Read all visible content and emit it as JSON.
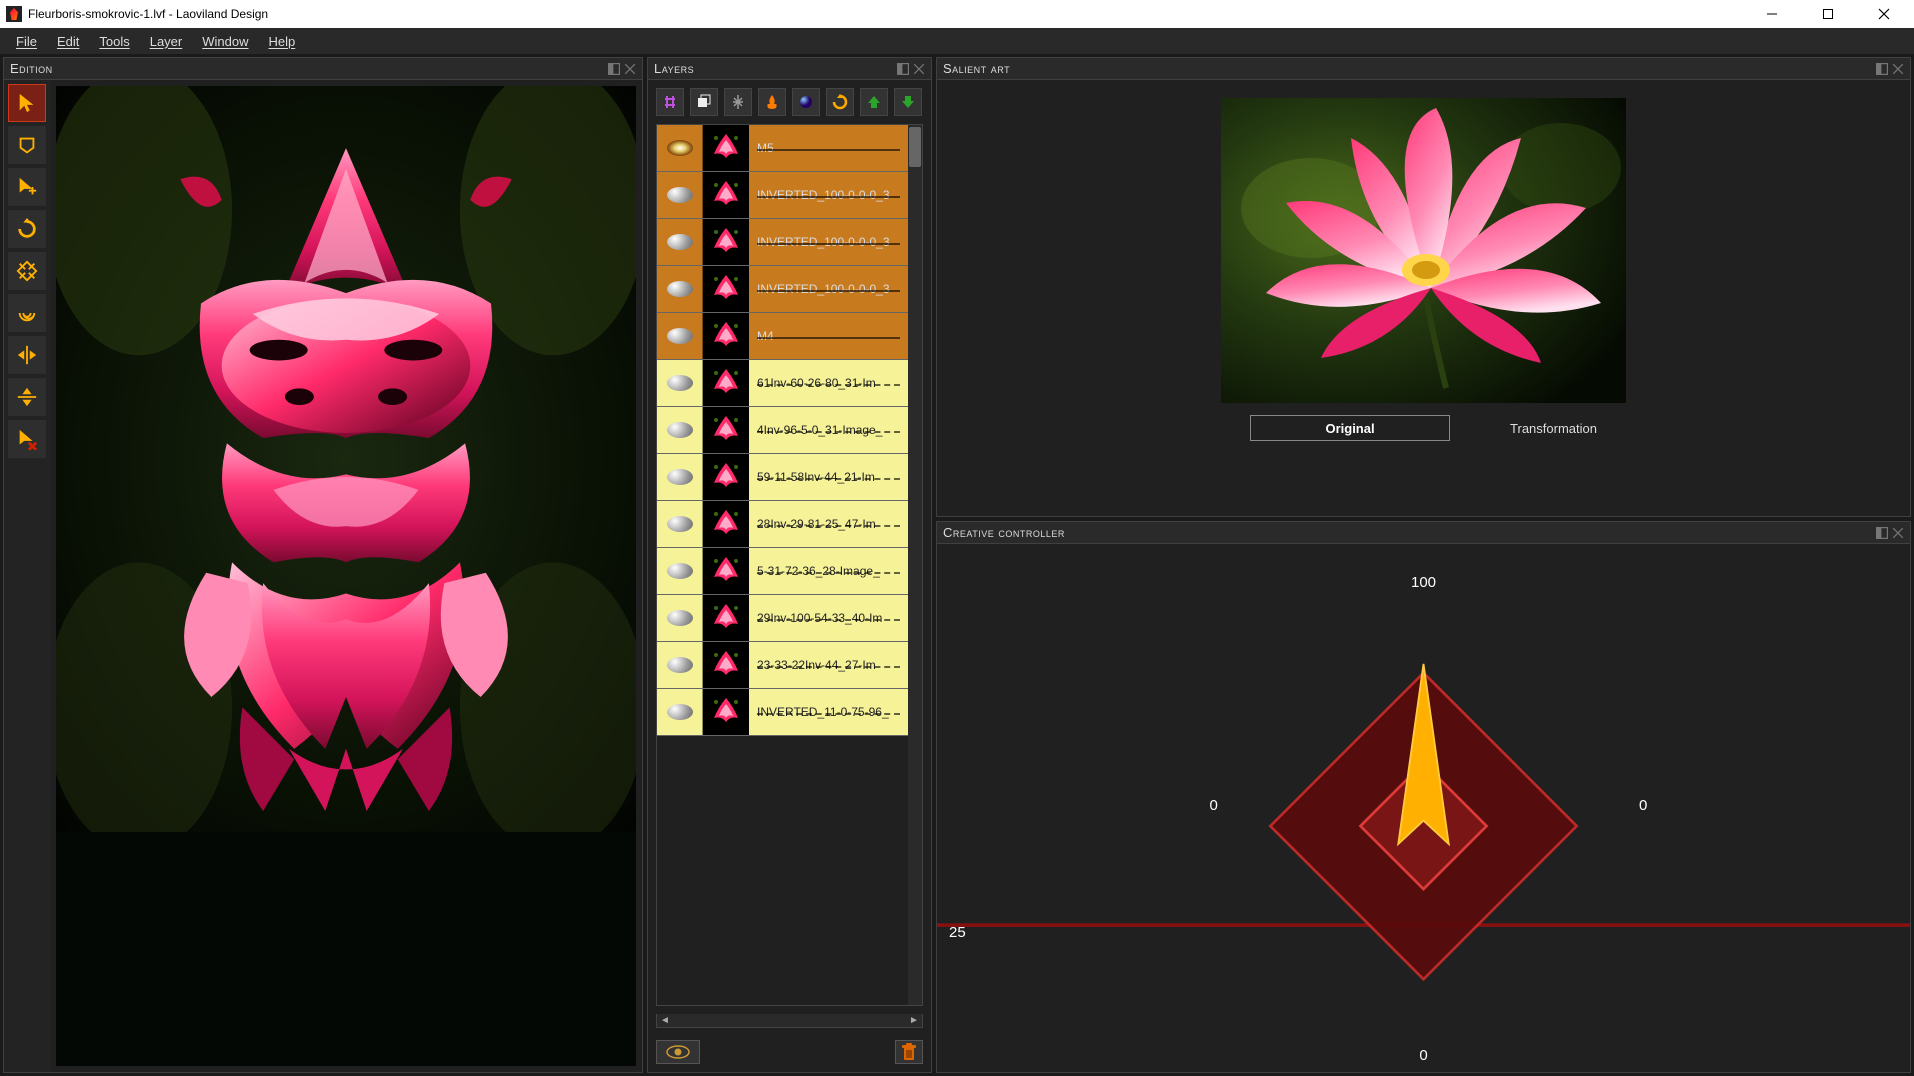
{
  "window": {
    "title": "Fleurboris-smokrovic-1.lvf - Laoviland Design"
  },
  "menu": {
    "file": "File",
    "edit": "Edit",
    "tools": "Tools",
    "layer": "Layer",
    "window": "Window",
    "help": "Help"
  },
  "panels": {
    "edition": {
      "title": "Edition"
    },
    "layers": {
      "title": "Layers"
    },
    "salient": {
      "title": "Salient art"
    },
    "creative": {
      "title": "Creative controller"
    }
  },
  "tools": [
    {
      "name": "select-tool",
      "active": true
    },
    {
      "name": "lasso-tool",
      "active": false
    },
    {
      "name": "move-tool",
      "active": false
    },
    {
      "name": "rotate-tool",
      "active": false
    },
    {
      "name": "scale-tool",
      "active": false
    },
    {
      "name": "swirl-tool",
      "active": false
    },
    {
      "name": "flip-h-tool",
      "active": false
    },
    {
      "name": "flip-v-tool",
      "active": false
    },
    {
      "name": "delete-point-tool",
      "active": false
    }
  ],
  "layer_toolbar": [
    {
      "name": "hash-icon",
      "color": "#b040d0"
    },
    {
      "name": "duplicate-icon",
      "color": "#eee"
    },
    {
      "name": "merge-icon",
      "color": "#888"
    },
    {
      "name": "flame-icon",
      "color": "#ff7a00"
    },
    {
      "name": "sphere-icon",
      "color": "#3a7aff"
    },
    {
      "name": "reload-icon",
      "color": "#ffaa00"
    },
    {
      "name": "arrow-up-icon",
      "color": "#2aa52a"
    },
    {
      "name": "arrow-down-icon",
      "color": "#2aa52a"
    }
  ],
  "layers_list": [
    {
      "label": "M5",
      "style": "orange",
      "eye": true
    },
    {
      "label": "INVERTED_100-0-0-0_3",
      "style": "orange",
      "eye": false
    },
    {
      "label": "INVERTED_100-0-0-0_3",
      "style": "orange",
      "eye": false
    },
    {
      "label": "INVERTED_100-0-0-0_3",
      "style": "orange",
      "eye": false
    },
    {
      "label": "M4",
      "style": "orange",
      "eye": false
    },
    {
      "label": "61Inv-60-26-80_31-Im",
      "style": "yellow",
      "eye": false
    },
    {
      "label": "4Inv-96-5-0_31-Image_",
      "style": "yellow",
      "eye": false
    },
    {
      "label": "59-11-58Inv-44_21-Im",
      "style": "yellow",
      "eye": false
    },
    {
      "label": "28Inv-29-81-25_47-Im",
      "style": "yellow",
      "eye": false
    },
    {
      "label": "5-31-72-36_28-Image_",
      "style": "yellow",
      "eye": false
    },
    {
      "label": "29Inv-100-54-33_40-Im",
      "style": "yellow",
      "eye": false
    },
    {
      "label": "23-33-22Inv-44_27-Im",
      "style": "yellow",
      "eye": false
    },
    {
      "label": "INVERTED_11-0-75-96_",
      "style": "yellow",
      "eye": false
    }
  ],
  "salient_tabs": {
    "original": "Original",
    "transformation": "Transformation"
  },
  "creative_values": {
    "top": "100",
    "left": "0",
    "right": "0",
    "bottom": "0",
    "far_left": "25"
  }
}
